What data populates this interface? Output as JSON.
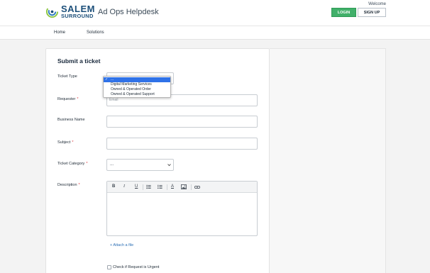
{
  "header": {
    "logo_line1": "SALEM",
    "logo_line2": "SURROUND",
    "site_title": "Ad Ops Helpdesk",
    "welcome": "Welcome",
    "login_label": "LOGIN",
    "signup_label": "SIGN UP"
  },
  "nav": {
    "items": [
      {
        "label": "Home"
      },
      {
        "label": "Solutions"
      }
    ]
  },
  "form": {
    "title": "Submit a ticket",
    "ticket_type": {
      "label": "Ticket Type",
      "value": "..."
    },
    "ticket_type_options": [
      {
        "label": "...",
        "selected": true
      },
      {
        "label": "Digital Marketing Services"
      },
      {
        "label": "Owned & Operated Order"
      },
      {
        "label": "Owned & Operated Support"
      }
    ],
    "requester": {
      "label": "Requester",
      "required_mark": "*",
      "placeholder": "Email"
    },
    "business_name": {
      "label": "Business Name"
    },
    "subject": {
      "label": "Subject",
      "required_mark": "*"
    },
    "ticket_category": {
      "label": "Ticket Category",
      "required_mark": "*",
      "value": "..."
    },
    "description": {
      "label": "Description",
      "required_mark": "*",
      "toolbar": {
        "bold": "B",
        "italic": "I",
        "underline": "U",
        "font_color": "A"
      }
    },
    "attach_label": "+ Attach a file",
    "urgent_label": "Check if Request is Urgent"
  },
  "colors": {
    "login_green": "#41b06a",
    "brand_blue": "#1c4f7a",
    "required_red": "#e0383f",
    "link_blue": "#2b6fb5",
    "selected_blue": "#2f72e8"
  }
}
